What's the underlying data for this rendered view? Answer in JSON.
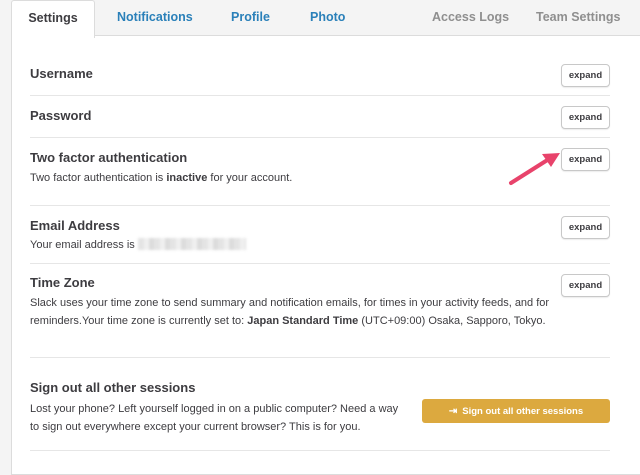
{
  "tabs": {
    "settings": "Settings",
    "notifications": "Notifications",
    "profile": "Profile",
    "photo": "Photo",
    "access_logs": "Access Logs",
    "team_settings": "Team Settings"
  },
  "sections": {
    "username": {
      "title": "Username",
      "button": "expand"
    },
    "password": {
      "title": "Password",
      "button": "expand"
    },
    "two_factor": {
      "title": "Two factor authentication",
      "desc_before": "Two factor authentication is",
      "desc_status": "inactive",
      "desc_after": "for your account.",
      "button": "expand"
    },
    "email": {
      "title": "Email Address",
      "desc": "Your email address is",
      "button": "expand"
    },
    "timezone": {
      "title": "Time Zone",
      "desc_before": "Slack uses your time zone to send summary and notification emails, for times in your activity feeds, and for reminders.Your time zone is currently set to:",
      "desc_zone": "Japan Standard Time",
      "desc_after": "(UTC+09:00) Osaka, Sapporo, Tokyo.",
      "button": "expand"
    },
    "signout": {
      "title": "Sign out all other sessions",
      "desc": "Lost your phone? Left yourself logged in on a public computer? Need a way to sign out everywhere except your current browser? This is for you.",
      "button": "Sign out all other sessions"
    }
  },
  "colors": {
    "link_blue": "#2a80b9",
    "signout_button": "#dca93f",
    "annotation_arrow": "#e8436b"
  },
  "icons": {
    "signout": "sign-out-icon",
    "annotation": "annotation-arrow"
  }
}
